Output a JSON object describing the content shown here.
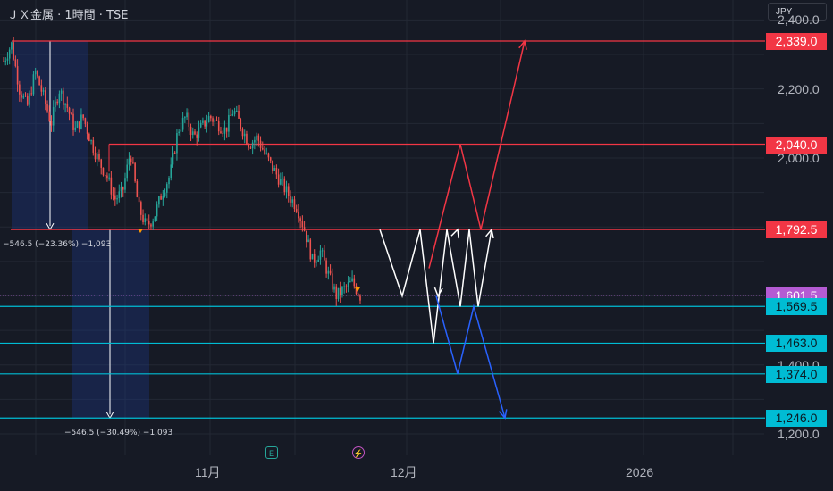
{
  "symbol": "ＪＸ金属 · 1時間 · TSE",
  "currency": "JPY",
  "colors": {
    "background": "#161a25",
    "up_candle": "#26a69a",
    "down_candle": "#ef5350",
    "resistance": "#f23645",
    "support": "#00bcd4",
    "current": "#b45bd3",
    "bull_path": "#f23645",
    "bear_path": "#2962ff",
    "scenario_path": "#ffffff",
    "measure_fill": "#1e3a8a"
  },
  "chart_data": {
    "type": "candlestick",
    "x_ticks": [
      "11月",
      "12月",
      "2026"
    ],
    "y_ticks": [
      2400,
      2200,
      2000,
      1400,
      1200
    ],
    "ylim": [
      1138,
      2458
    ],
    "price_levels": [
      {
        "value": 2339.0,
        "label": "2,339.0",
        "kind": "resistance"
      },
      {
        "value": 2040.0,
        "label": "2,040.0",
        "kind": "resistance"
      },
      {
        "value": 1792.5,
        "label": "1,792.5",
        "kind": "resistance"
      },
      {
        "value": 1601.5,
        "label": "1,601.5",
        "kind": "current"
      },
      {
        "value": 1569.5,
        "label": "1,569.5",
        "kind": "support"
      },
      {
        "value": 1463.0,
        "label": "1,463.0",
        "kind": "support"
      },
      {
        "value": 1374.0,
        "label": "1,374.0",
        "kind": "support"
      },
      {
        "value": 1246.0,
        "label": "1,246.0",
        "kind": "support"
      }
    ],
    "measurements": [
      {
        "label": "−546.5 (−23.36%) −1,093",
        "from": 2339.0,
        "to": 1792.5
      },
      {
        "label": "−546.5 (−30.49%) −1,093",
        "from": 1792.5,
        "to": 1246.0
      }
    ],
    "price_path_prices": [
      2280,
      2330,
      2200,
      2150,
      2250,
      2180,
      2100,
      2200,
      2150,
      2080,
      2120,
      2050,
      1990,
      1950,
      1880,
      1900,
      2020,
      1860,
      1800,
      1830,
      1900,
      1950,
      2080,
      2120,
      2060,
      2090,
      2120,
      2100,
      2080,
      2140,
      2090,
      2040,
      2060,
      2010,
      1970,
      1930,
      1890,
      1860,
      1790,
      1700,
      1730,
      1660,
      1600,
      1620,
      1640,
      1600
    ],
    "scenario_path": [
      [
        425,
        1792.5
      ],
      [
        450,
        1600
      ],
      [
        470,
        1792.5
      ],
      [
        485,
        1463
      ],
      [
        500,
        1792.5
      ],
      [
        515,
        1569.5
      ],
      [
        525,
        1792.5
      ],
      [
        535,
        1569.5
      ],
      [
        550,
        1792.5
      ]
    ],
    "bull_path": [
      [
        480,
        1680
      ],
      [
        515,
        2040
      ],
      [
        538,
        1792.5
      ],
      [
        587,
        2339
      ]
    ],
    "bear_path": [
      [
        488,
        1600
      ],
      [
        512,
        1374
      ],
      [
        530,
        1569.5
      ],
      [
        565,
        1246
      ]
    ]
  }
}
